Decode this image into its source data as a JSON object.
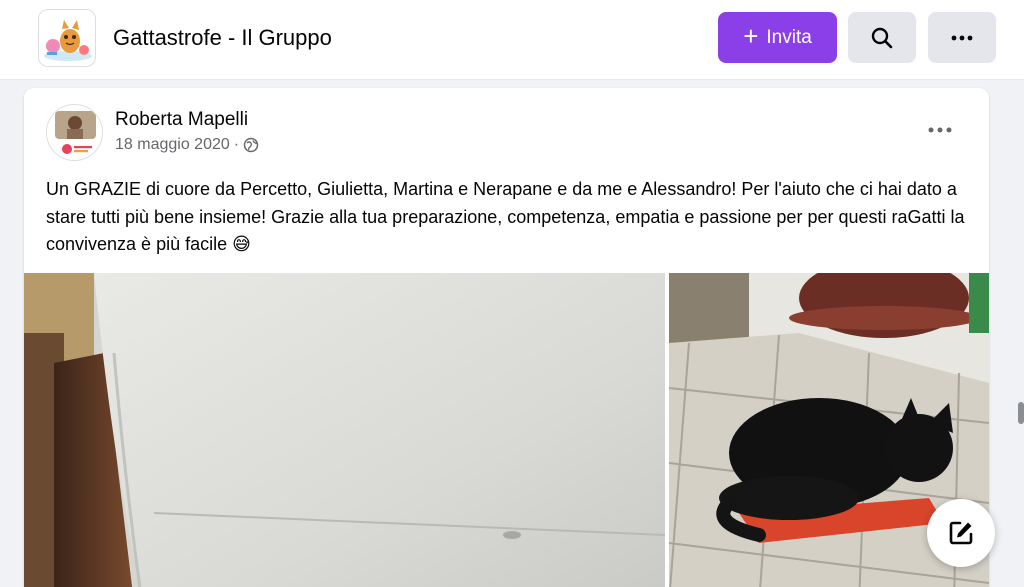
{
  "header": {
    "group_name": "Gattastrofe - Il Gruppo",
    "invite_label": "Invita",
    "accent_color": "#8b3fe8"
  },
  "post": {
    "author": "Roberta Mapelli",
    "date": "18 maggio 2020",
    "separator": "·",
    "privacy_icon": "globe-icon",
    "text": "Un GRAZIE di cuore da Percetto, Giulietta, Martina e Nerapane e da me e Alessandro! Per l'aiuto che ci hai dato a stare tutti più bene insieme! Grazie alla tua preparazione, competenza, empatia e passione per per questi raGatti la convivenza è più facile 😅"
  },
  "icons": {
    "search": "search-icon",
    "more": "more-options-icon",
    "compose": "compose-icon"
  }
}
